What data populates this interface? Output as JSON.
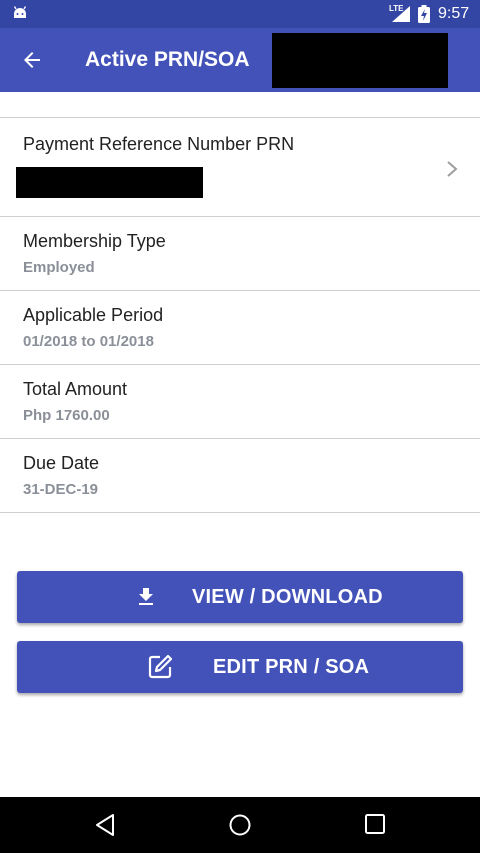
{
  "status_bar": {
    "network": "LTE",
    "time": "9:57",
    "icons": [
      "android-icon",
      "signal-icon",
      "battery-icon"
    ]
  },
  "app_bar": {
    "title": "Active PRN/SOA",
    "back_icon": "arrow-left-icon",
    "background": "#4352b9"
  },
  "details": {
    "prn_label": "Payment Reference Number PRN",
    "rows": [
      {
        "label": "Membership Type",
        "value": "Employed"
      },
      {
        "label": "Applicable Period",
        "value": "01/2018 to 01/2018"
      },
      {
        "label": "Total Amount",
        "value": "Php 1760.00"
      },
      {
        "label": "Due Date",
        "value": "31-DEC-19"
      }
    ]
  },
  "actions": {
    "view_download": {
      "label": "VIEW / DOWNLOAD",
      "icon": "download-icon"
    },
    "edit": {
      "label": "EDIT PRN / SOA",
      "icon": "edit-icon"
    }
  },
  "nav_bar": {
    "icons": [
      "nav-back-icon",
      "nav-home-icon",
      "nav-recents-icon"
    ]
  },
  "colors": {
    "primary": "#4352b9",
    "status_bar": "#3446a4",
    "value_text": "#8a8f98",
    "divider": "#cfcfcf"
  }
}
